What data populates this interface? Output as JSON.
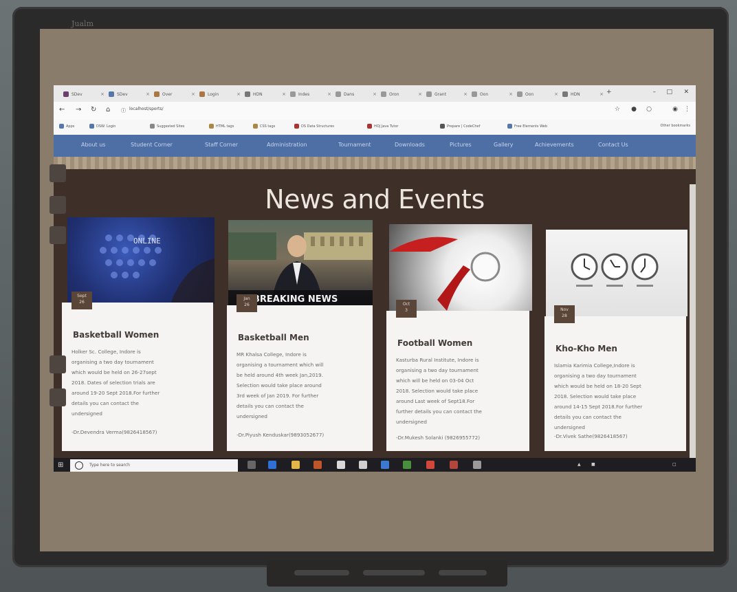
{
  "board": {
    "brand": "Jualm"
  },
  "browser": {
    "tabs": [
      {
        "label": "SDev",
        "color": "#6b3f6b"
      },
      {
        "label": "SDev",
        "color": "#5577aa"
      },
      {
        "label": "Over",
        "color": "#aa7744"
      },
      {
        "label": "Login",
        "color": "#aa7744"
      },
      {
        "label": "HDN",
        "color": "#777777"
      },
      {
        "label": "Indes",
        "color": "#999999"
      },
      {
        "label": "Dans",
        "color": "#999999"
      },
      {
        "label": "Oron",
        "color": "#999999"
      },
      {
        "label": "Grant",
        "color": "#999999"
      },
      {
        "label": "Oon",
        "color": "#999999"
      },
      {
        "label": "Oon",
        "color": "#999999"
      },
      {
        "label": "HDN",
        "color": "#777777"
      }
    ],
    "url": "localhost/sports/",
    "bookmarks": [
      {
        "label": "Apps",
        "color": "#5577aa"
      },
      {
        "label": "DSW: Login",
        "color": "#5577aa"
      },
      {
        "label": "Suggested Sites",
        "color": "#888888"
      },
      {
        "label": "HTML tags",
        "color": "#aa8844"
      },
      {
        "label": "CSS tags",
        "color": "#aa8844"
      },
      {
        "label": "DS Data Structures",
        "color": "#aa3333"
      },
      {
        "label": "HOJ Java Tutor",
        "color": "#aa3333"
      },
      {
        "label": "Prepare | CodeChef",
        "color": "#555555"
      },
      {
        "label": "Free Elements Web",
        "color": "#5577aa"
      }
    ],
    "other_bookmarks": "Other bookmarks"
  },
  "site": {
    "nav": [
      "About us",
      "Student Corner",
      "Staff Corner",
      "Administration",
      "Tournament",
      "Downloads",
      "Pictures",
      "Gallery",
      "Achievements",
      "Contact Us"
    ],
    "title": "News and Events",
    "cards": [
      {
        "img_text": "ONLINE",
        "month": "Sept",
        "day": "26",
        "title": "Basketball Women",
        "body": "Holker Sc. College, Indore is\norganising a two day tournament\nwhich would be held on 26-27sept\n2018. Dates of selection trials are\naround 19-20 Sept 2018.For further\ndetails you can contact the\nundersigned",
        "contact": "-Dr.Devendra Verma(9826418567)"
      },
      {
        "img_text": "BREAKING NEWS",
        "month": "Jan",
        "day": "26",
        "title": "Basketball Men",
        "body": "MR Khalsa College, Indore is\norganising a tournament which will\nbe held around 4th week Jan,2019.\nSelection would take place around\n3rd week of Jan 2019. For further\ndetails you can contact the\nundersigned",
        "contact": "-Dr.Piyush Kenduskar(9893052677)"
      },
      {
        "img_text": "",
        "month": "Oct",
        "day": "3",
        "title": "Football Women",
        "body": "Kasturba Rural Institute, Indore is\norganising a two day tournament\nwhich will be held on 03-04 Oct\n2018. Selection would take place\naround Last week of Sept18.For\nfurther details you can contact the\nundersigned",
        "contact": "-Dr.Mukesh Solanki (9826955772)"
      },
      {
        "img_text": "",
        "month": "Nov",
        "day": "28",
        "title": "Kho-Kho Men",
        "body": "Islamia Karimia College,Indore is\norganising a two day tournament\nwhich would be held on 18-20 Sept\n2018. Selection would take place\naround 14-15 Sept 2018.For further\ndetails you can contact the\nundersigned",
        "contact": "-Dr.Vivek Sathe(9826418567)"
      }
    ]
  },
  "taskbar": {
    "search_placeholder": "Type here to search"
  }
}
